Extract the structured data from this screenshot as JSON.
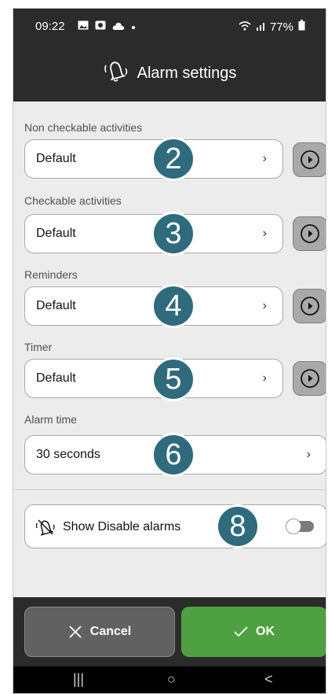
{
  "status": {
    "time": "09:22",
    "battery": "77%"
  },
  "title": "Alarm settings",
  "sections": [
    {
      "label": "Non checkable activities",
      "value": "Default",
      "badge": "2"
    },
    {
      "label": "Checkable activities",
      "value": "Default",
      "badge": "3"
    },
    {
      "label": "Reminders",
      "value": "Default",
      "badge": "4"
    },
    {
      "label": "Timer",
      "value": "Default",
      "badge": "5"
    },
    {
      "label": "Alarm time",
      "value": "30 seconds",
      "badge": "6"
    }
  ],
  "chevron": "›",
  "toggle": {
    "label": "Show Disable alarms",
    "badge": "8",
    "on": false
  },
  "buttons": {
    "cancel": "Cancel",
    "ok": "OK"
  },
  "nav": {
    "recents": "|||",
    "home": "○",
    "back": "<"
  },
  "colors": {
    "bar": "#2b2b2b",
    "ok": "#4fa040",
    "cancel": "#616161",
    "badge": "#2f6b7d",
    "play": "#a9a9a9"
  },
  "icons": [
    "photo-icon",
    "screen-record-icon",
    "cloud-icon",
    "wifi-icon",
    "signal-icon",
    "battery-icon",
    "alarm-bell-icon",
    "play-icon",
    "alarm-off-icon",
    "close-icon",
    "check-icon"
  ]
}
